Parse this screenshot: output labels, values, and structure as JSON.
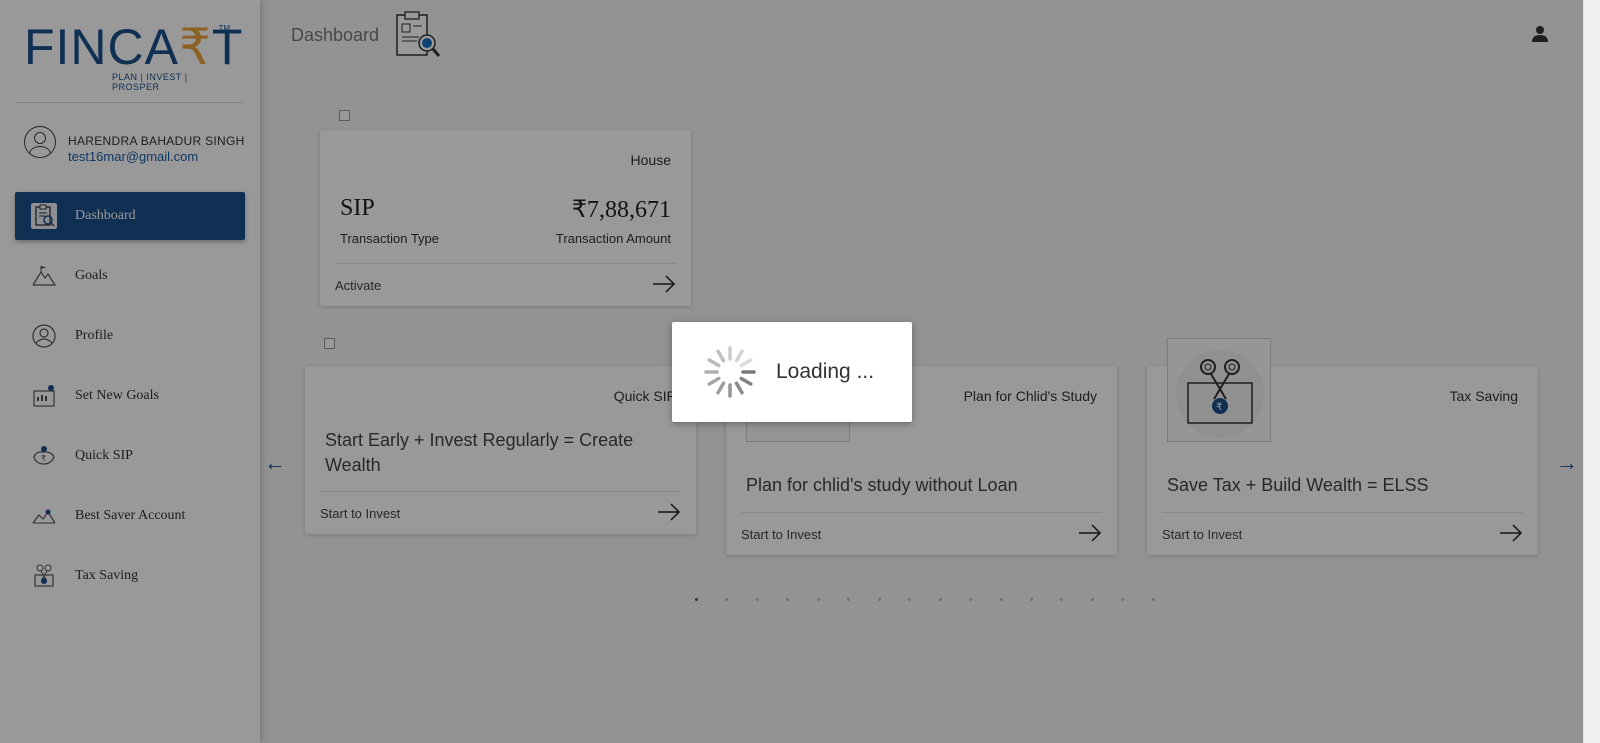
{
  "brand": {
    "logo_main": "FINCA",
    "logo_rupee": "₹",
    "logo_end": "T",
    "logo_tm": "TM",
    "tagline": "PLAN | INVEST | PROSPER"
  },
  "user": {
    "name": "HARENDRA BAHADUR SINGH",
    "email": "test16mar@gmail.com"
  },
  "nav": {
    "items": [
      {
        "label": "Dashboard",
        "icon": "dashboard-icon",
        "active": true
      },
      {
        "label": "Goals",
        "icon": "goals-icon"
      },
      {
        "label": "Profile",
        "icon": "profile-icon"
      },
      {
        "label": "Set New Goals",
        "icon": "set-new-goals-icon"
      },
      {
        "label": "Quick SIP",
        "icon": "quick-sip-icon"
      },
      {
        "label": "Best Saver Account",
        "icon": "best-saver-icon"
      },
      {
        "label": "Tax Saving",
        "icon": "tax-saving-icon"
      }
    ]
  },
  "header": {
    "title": "Dashboard"
  },
  "goal_card": {
    "goal_name": "House",
    "transaction_type": "SIP",
    "transaction_type_label": "Transaction Type",
    "transaction_amount": "₹7,88,671",
    "transaction_amount_label": "Transaction Amount",
    "action_label": "Activate"
  },
  "invest_cards": [
    {
      "title": "Quick SIP",
      "text": "Start Early + Invest Regularly = Create Wealth",
      "action_label": "Start to Invest"
    },
    {
      "title": "Plan for Chlid's Study",
      "text": "Plan for chlid's study without Loan",
      "action_label": "Start to Invest"
    },
    {
      "title": "Tax Saving",
      "text": "Save Tax + Build Wealth = ELSS",
      "action_label": "Start to Invest"
    }
  ],
  "carousel": {
    "prev_arrow": "←",
    "next_arrow": "→",
    "dot_count": 16,
    "active_dot": 0
  },
  "loading": {
    "text": "Loading  ..."
  },
  "colors": {
    "brand_blue": "#1a4f8b",
    "brand_gold": "#e8a33c",
    "email_blue": "#1a5ea8"
  }
}
